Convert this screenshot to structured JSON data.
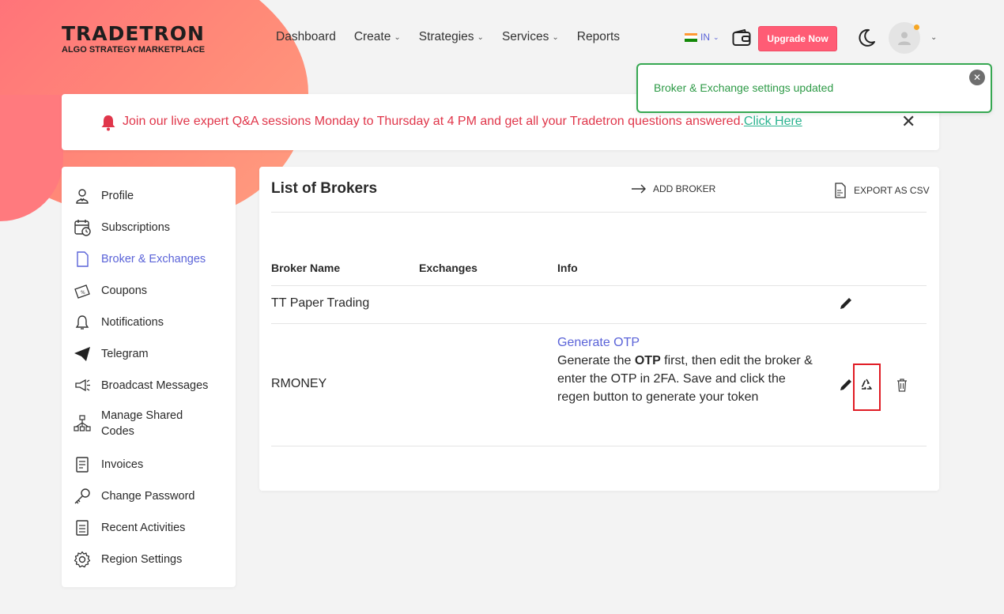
{
  "brand": {
    "name": "TRADETRON",
    "tagline": "ALGO STRATEGY MARKETPLACE"
  },
  "nav": {
    "items": [
      {
        "label": "Dashboard"
      },
      {
        "label": "Create"
      },
      {
        "label": "Strategies"
      },
      {
        "label": "Services"
      },
      {
        "label": "Reports"
      }
    ],
    "region_code": "IN",
    "upgrade_label": "Upgrade Now"
  },
  "toast": {
    "message": "Broker & Exchange settings updated"
  },
  "banner": {
    "message": "Join our live expert Q&A sessions Monday to Thursday at 4 PM and get all your Tradetron questions answered.",
    "link_label": "Click Here"
  },
  "sidebar": {
    "items": [
      {
        "label": "Profile"
      },
      {
        "label": "Subscriptions"
      },
      {
        "label": "Broker & Exchanges"
      },
      {
        "label": "Coupons"
      },
      {
        "label": "Notifications"
      },
      {
        "label": "Telegram"
      },
      {
        "label": "Broadcast Messages"
      },
      {
        "label": "Manage Shared"
      },
      {
        "label": "Codes"
      },
      {
        "label": "Invoices"
      },
      {
        "label": "Change Password"
      },
      {
        "label": "Recent Activities"
      },
      {
        "label": "Region Settings"
      }
    ]
  },
  "main": {
    "title": "List of Brokers",
    "add_broker_label": "ADD BROKER",
    "export_label": "EXPORT AS CSV",
    "columns": [
      "Broker Name",
      "Exchanges",
      "Info"
    ],
    "rows": [
      {
        "broker": "TT Paper Trading",
        "exchanges": "",
        "info": ""
      },
      {
        "broker": "RMONEY",
        "exchanges": "",
        "info_link": "Generate OTP",
        "info_pre": "Generate the ",
        "info_bold": "OTP",
        "info_post": " first, then edit the broker & enter the OTP in 2FA. Save and click the regen button to generate your token"
      }
    ]
  },
  "colors": {
    "accent": "#5a63d8",
    "brand_pink": "#ff5c75",
    "success": "#36a852",
    "alert_red": "#e0364a",
    "link_green": "#2bb38f"
  }
}
